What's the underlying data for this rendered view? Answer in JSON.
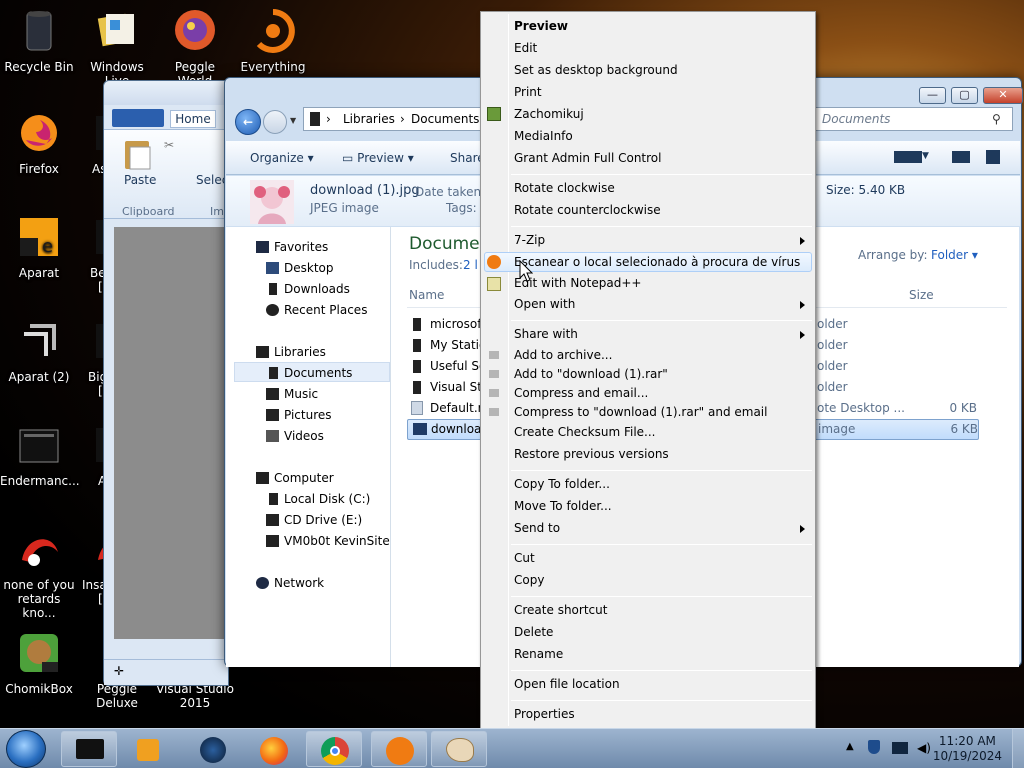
{
  "desktop": {
    "icons": [
      "Recycle Bin",
      "Windows Live",
      "Peggle World",
      "Everything",
      "Firefox",
      "Aparat",
      "Aparat (2)",
      "Endermanc...",
      "none of you retards kno...",
      "ChomikBox",
      "Peggle Deluxe",
      "Visual Studio 2015"
    ],
    "partial_labels": [
      "As",
      "Be",
      "Big",
      "A",
      "Insa"
    ],
    "partial_labels_2": [
      "[",
      "[",
      "["
    ]
  },
  "explorer": {
    "ribbon": {
      "tab_home": "Home",
      "paste": "Paste",
      "select": "Selec",
      "clipboard": "Clipboard",
      "img_group": "Im"
    },
    "address": {
      "seg1": "Libraries",
      "seg2": "Documents"
    },
    "search_placeholder": "Documents",
    "toolbar": {
      "organize": "Organize",
      "preview": "Preview",
      "share": "Share"
    },
    "details": {
      "file_name": "download (1).jpg",
      "date_taken_label": "Date taken:",
      "file_type": "JPEG image",
      "tags_label": "Tags:",
      "size": "Size: 5.40 KB"
    },
    "nav": {
      "favorites": "Favorites",
      "desktop": "Desktop",
      "downloads": "Downloads",
      "recent": "Recent Places",
      "libraries": "Libraries",
      "documents": "Documents",
      "music": "Music",
      "pictures": "Pictures",
      "videos": "Videos",
      "computer": "Computer",
      "local_disk": "Local Disk (C:)",
      "cd_drive": "CD Drive (E:)",
      "vm": "VM0b0t KevinSite",
      "network": "Network"
    },
    "main": {
      "title": "Docume",
      "includes": "Includes:",
      "includes_link": "2 l",
      "arrange_label": "Arrange by:",
      "arrange_value": "Folder",
      "col_name": "Name",
      "col_size": "Size",
      "rows": [
        {
          "name": "microsof",
          "type": "older",
          "size": ""
        },
        {
          "name": "My Statio",
          "type": "older",
          "size": ""
        },
        {
          "name": "Useful So",
          "type": "older",
          "size": ""
        },
        {
          "name": "Visual Stu",
          "type": "older",
          "size": ""
        },
        {
          "name": "Default.rc",
          "type": "ote Desktop ...",
          "size": "0 KB"
        },
        {
          "name": "download",
          "type": "image",
          "size": "6 KB"
        }
      ]
    }
  },
  "context_menu": {
    "items": [
      "Preview",
      "Edit",
      "Set as desktop background",
      "Print",
      "Zachomikuj",
      "MediaInfo",
      "Grant Admin Full Control",
      "Rotate clockwise",
      "Rotate counterclockwise",
      "7-Zip",
      "Escanear o local selecionado à procura de vírus",
      "Edit with Notepad++",
      "Open with",
      "Share with",
      "Add to archive...",
      "Add to \"download (1).rar\"",
      "Compress and email...",
      "Compress to \"download (1).rar\" and email",
      "Create Checksum File...",
      "Restore previous versions",
      "Copy To folder...",
      "Move To folder...",
      "Send to",
      "Cut",
      "Copy",
      "Create shortcut",
      "Delete",
      "Rename",
      "Open file location",
      "Properties"
    ]
  },
  "taskbar": {
    "time": "11:20 AM",
    "date": "10/19/2024"
  }
}
